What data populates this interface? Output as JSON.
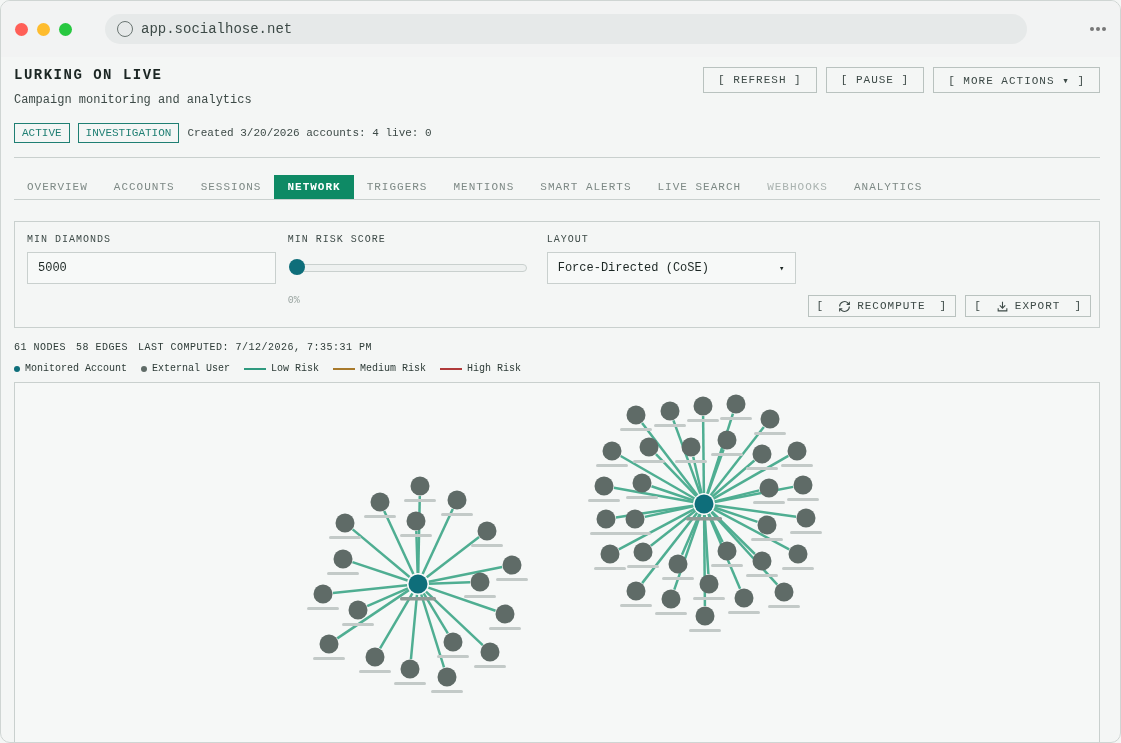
{
  "browser": {
    "url": "app.socialhose.net"
  },
  "header": {
    "title": "LURKING ON LIVE",
    "subtitle": "Campaign monitoring and analytics",
    "badges": [
      "ACTIVE",
      "INVESTIGATION"
    ],
    "meta": "Created 3/20/2026 accounts: 4 live: 0"
  },
  "actions": [
    {
      "label": "[ REFRESH ]"
    },
    {
      "label": "[ PAUSE ]"
    },
    {
      "label": "[ MORE ACTIONS ▾ ]"
    }
  ],
  "tabs": [
    {
      "label": "OVERVIEW",
      "selected": false,
      "disabled": false
    },
    {
      "label": "ACCOUNTS",
      "selected": false,
      "disabled": false
    },
    {
      "label": "SESSIONS",
      "selected": false,
      "disabled": false
    },
    {
      "label": "NETWORK",
      "selected": true,
      "disabled": false
    },
    {
      "label": "TRIGGERS",
      "selected": false,
      "disabled": false
    },
    {
      "label": "MENTIONS",
      "selected": false,
      "disabled": false
    },
    {
      "label": "SMART ALERTS",
      "selected": false,
      "disabled": false
    },
    {
      "label": "LIVE SEARCH",
      "selected": false,
      "disabled": false
    },
    {
      "label": "WEBHOOKS",
      "selected": false,
      "disabled": true
    },
    {
      "label": "ANALYTICS",
      "selected": false,
      "disabled": false
    }
  ],
  "filters": {
    "min_diamonds": {
      "label": "MIN DIAMONDS",
      "value": "5000"
    },
    "min_risk_score": {
      "label": "MIN RISK SCORE",
      "level": 0,
      "reading": "0%"
    },
    "layout": {
      "label": "LAYOUT",
      "value": "Force-Directed (CoSE)",
      "caret": "▾"
    },
    "buttons": [
      {
        "open": "[",
        "label": "RECOMPUTE",
        "close": "]",
        "kind": "refresh"
      },
      {
        "open": "[",
        "label": "EXPORT",
        "close": "]",
        "kind": "download"
      }
    ]
  },
  "stats": [
    "61 NODES",
    "58 EDGES",
    "LAST COMPUTED: 7/12/2026, 7:35:31 PM"
  ],
  "legend": [
    {
      "label": "Monitored Account",
      "kind": "dot",
      "color": "#0e6e7a"
    },
    {
      "label": "External User",
      "kind": "dot",
      "color": "#5f6b67"
    },
    {
      "label": "Low Risk",
      "kind": "line",
      "color": "#2f9a7f"
    },
    {
      "label": "Medium Risk",
      "kind": "line",
      "color": "#a87a2c"
    },
    {
      "label": "High Risk",
      "kind": "line",
      "color": "#b03a3a"
    }
  ],
  "graph": {
    "clusters": [
      {
        "center": {
          "kind": "monitored"
        },
        "members": [
          {
            "kind": "external"
          },
          {
            "kind": "external"
          },
          {
            "kind": "external"
          },
          {
            "kind": "external"
          },
          {
            "kind": "external"
          },
          {
            "kind": "external"
          },
          {
            "kind": "external"
          },
          {
            "kind": "external"
          },
          {
            "kind": "external"
          },
          {
            "kind": "external"
          },
          {
            "kind": "external"
          },
          {
            "kind": "external"
          },
          {
            "kind": "external"
          },
          {
            "kind": "external"
          },
          {
            "kind": "external"
          },
          {
            "kind": "external"
          },
          {
            "kind": "external"
          },
          {
            "kind": "external"
          }
        ]
      },
      {
        "center": {
          "kind": "monitored"
        },
        "members": [
          {
            "kind": "external"
          },
          {
            "kind": "external"
          },
          {
            "kind": "external"
          },
          {
            "kind": "external"
          },
          {
            "kind": "external"
          },
          {
            "kind": "external"
          },
          {
            "kind": "external"
          },
          {
            "kind": "external"
          },
          {
            "kind": "external"
          },
          {
            "kind": "external"
          },
          {
            "kind": "external"
          },
          {
            "kind": "external"
          },
          {
            "kind": "external"
          },
          {
            "kind": "external"
          },
          {
            "kind": "external"
          },
          {
            "kind": "external"
          },
          {
            "kind": "external"
          },
          {
            "kind": "external"
          },
          {
            "kind": "external"
          },
          {
            "kind": "external"
          },
          {
            "kind": "external"
          },
          {
            "kind": "external"
          },
          {
            "kind": "external"
          },
          {
            "kind": "external"
          },
          {
            "kind": "external"
          },
          {
            "kind": "external"
          },
          {
            "kind": "external"
          },
          {
            "kind": "external"
          },
          {
            "kind": "external"
          },
          {
            "kind": "external"
          },
          {
            "kind": "external"
          }
        ]
      }
    ]
  }
}
